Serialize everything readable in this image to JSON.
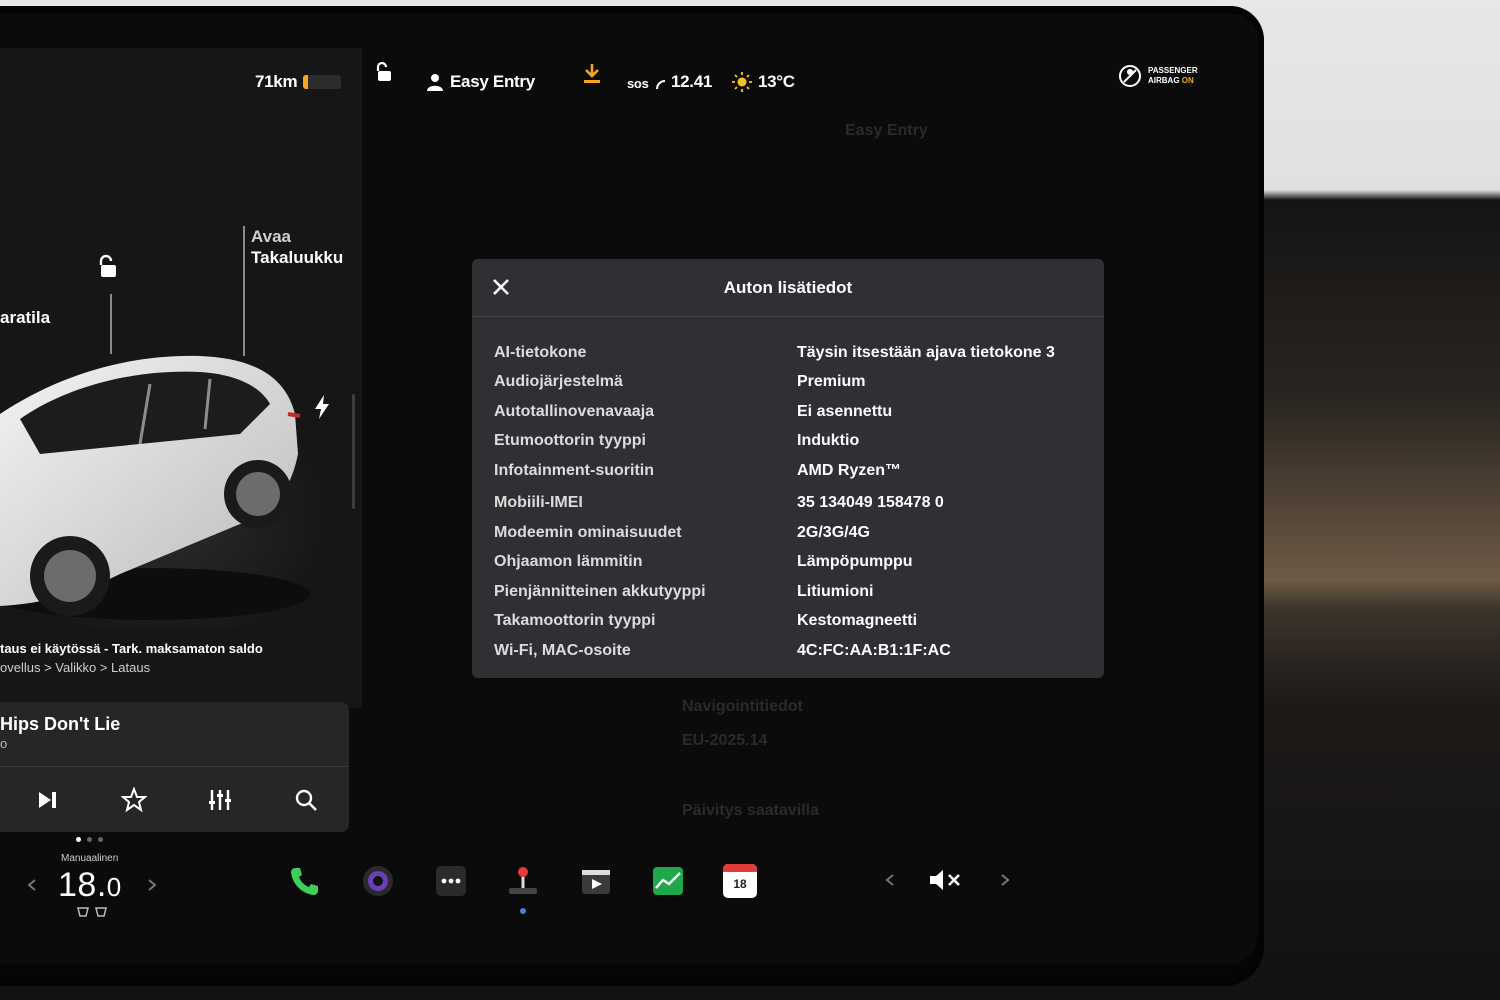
{
  "status_bar": {
    "range": "71km",
    "profile": "Easy Entry",
    "sos": "sos",
    "time": "12.41",
    "temperature": "13°C",
    "airbag_line1": "PASSENGER",
    "airbag_line2": "AIRBAG",
    "airbag_state": "ON"
  },
  "car_panel": {
    "trunk_label_1": "Avaa",
    "trunk_label_2": "Takaluukku",
    "frunk_label": "aratila",
    "charge_notice": "taus ei käytössä - Tark. maksamaton saldo",
    "charge_path": "ovellus > Valikko > Lataus"
  },
  "media": {
    "track_title": "Hips Don't Lie",
    "track_sub": "o"
  },
  "modal": {
    "title": "Auton lisätiedot",
    "rows": [
      {
        "key": "AI-tietokone",
        "value": "Täysin itsestään ajava tietokone 3"
      },
      {
        "key": "Audiojärjestelmä",
        "value": "Premium"
      },
      {
        "key": "Autotallinovenavaaja",
        "value": "Ei asennettu"
      },
      {
        "key": "Etumoottorin tyyppi",
        "value": "Induktio"
      },
      {
        "key": "Infotainment-suoritin",
        "value": "AMD Ryzen™"
      },
      {
        "key": "Mobiili-IMEI",
        "value": "35 134049 158478 0"
      },
      {
        "key": "Modeemin ominaisuudet",
        "value": "2G/3G/4G"
      },
      {
        "key": "Ohjaamon lämmitin",
        "value": "Lämpöpumppu"
      },
      {
        "key": "Pienjännitteinen akkutyyppi",
        "value": "Litiumioni"
      },
      {
        "key": "Takamoottorin tyyppi",
        "value": "Kestomagneetti"
      },
      {
        "key": "Wi-Fi, MAC-osoite",
        "value": "4C:FC:AA:B1:1F:AC"
      }
    ]
  },
  "background_ghost": {
    "profile": "Easy Entry",
    "nav_label": "Navigointitiedot",
    "nav_value": "EU-2025.14",
    "update_label": "Päivitys saatavilla"
  },
  "climate": {
    "mode": "Manuaalinen",
    "temp_int": "18.",
    "temp_dec": "0"
  },
  "dock": {
    "calendar_day": "18"
  },
  "colors": {
    "accent_orange": "#f5a623",
    "phone_green": "#3ecf5a",
    "stocks_green": "#1fa84a",
    "calendar_red": "#e23b3b"
  }
}
